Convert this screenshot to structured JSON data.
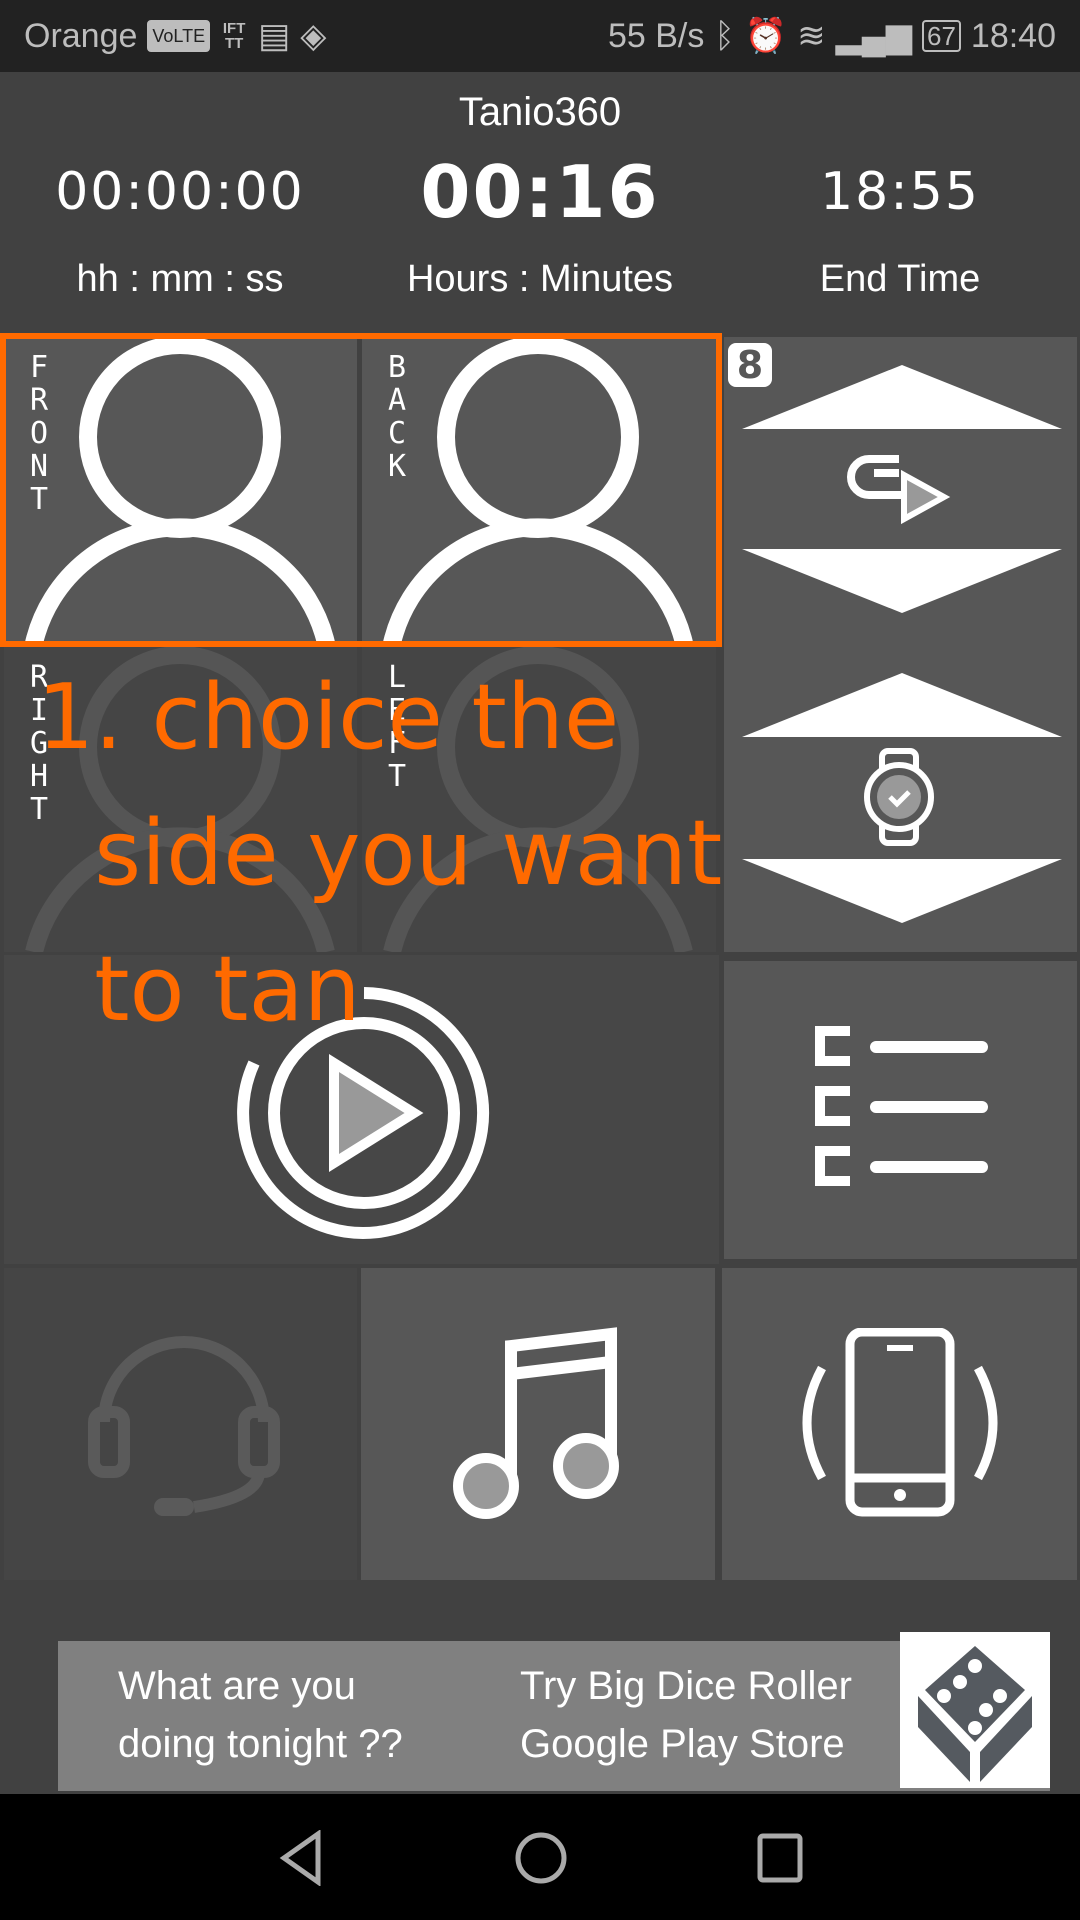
{
  "status_bar": {
    "carrier": "Orange",
    "volte": "VoLTE",
    "ifttt": "IFTTT",
    "net_speed": "55 B/s",
    "battery": "67",
    "time": "18:40"
  },
  "app": {
    "title": "Tanio360"
  },
  "timers": {
    "elapsed": "00:00:00",
    "elapsed_label": "hh : mm : ss",
    "duration": "00:16",
    "duration_label": "Hours : Minutes",
    "end_time": "18:55",
    "end_label": "End Time"
  },
  "sides": [
    {
      "label": "FRONT",
      "selected": true
    },
    {
      "label": "BACK",
      "selected": true
    },
    {
      "label": "RIGHT",
      "selected": false
    },
    {
      "label": "LEFT",
      "selected": false
    }
  ],
  "level_badge": "8",
  "annotation": "1. choice the\n  side you want\n  to tan",
  "annotation_color": "#ff6a00",
  "ad": {
    "left_text": "What are you\ndoing tonight ??",
    "right_text": "Try Big Dice Roller\nGoogle Play Store"
  },
  "icons": {
    "rotate": "rotate-play-icon",
    "watch": "watch-check-icon",
    "play": "play-circle-icon",
    "list": "checklist-icon",
    "headset": "headset-icon",
    "music": "music-note-icon",
    "phone": "phone-vibrate-icon"
  }
}
